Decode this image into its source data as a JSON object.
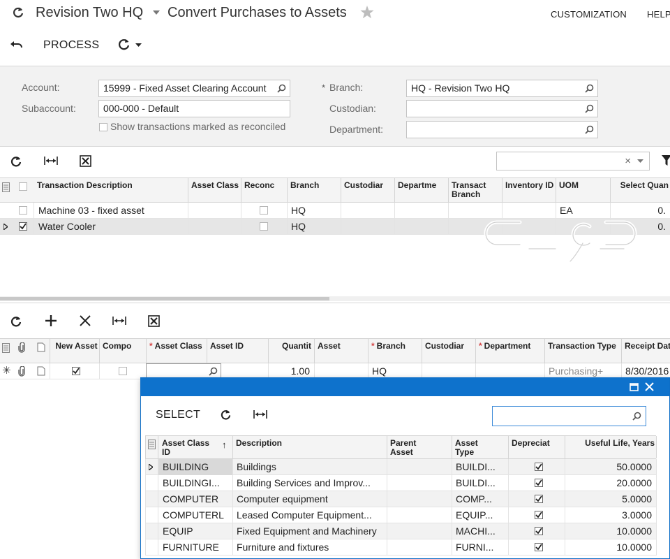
{
  "header": {
    "company": "Revision Two HQ",
    "screen_title": "Convert Purchases to Assets",
    "nav": [
      "CUSTOMIZATION",
      "HELP"
    ]
  },
  "toolbar": {
    "process": "PROCESS"
  },
  "filter": {
    "account_label": "Account:",
    "account_value": "15999 - Fixed Asset Clearing Account",
    "subaccount_label": "Subaccount:",
    "subaccount_value": "000-000 - Default",
    "reconciled_label": "Show transactions marked as reconciled",
    "branch_label": "Branch:",
    "branch_value": "HQ - Revision Two HQ",
    "custodian_label": "Custodian:",
    "custodian_value": "",
    "department_label": "Department:",
    "department_value": ""
  },
  "top_grid": {
    "columns": [
      "Transaction Description",
      "Asset Class",
      "Reconc",
      "Branch",
      "Custodiar",
      "Departme",
      "Transact Branch",
      "Inventory ID",
      "UOM",
      "Select Quan"
    ],
    "rows": [
      {
        "description": "Machine 03 - fixed asset",
        "branch": "HQ",
        "uom": "EA",
        "qty": "0.",
        "selected": false
      },
      {
        "description": "Water Cooler",
        "branch": "HQ",
        "uom": "",
        "qty": "0.",
        "selected": true
      }
    ],
    "watermark": "C_9_D"
  },
  "bottom_grid": {
    "columns": [
      "New Asset",
      "Compo",
      "Asset Class",
      "Asset ID",
      "Quantit",
      "Asset",
      "Branch",
      "Custodiar",
      "Department",
      "Transaction Type",
      "Receipt Dat"
    ],
    "row": {
      "quantity": "1.00",
      "branch": "HQ",
      "transaction_type": "Purchasing+",
      "receipt_date": "8/30/2016"
    }
  },
  "lookup": {
    "select_label": "SELECT",
    "search_placeholder": "",
    "columns": [
      "Asset Class ID",
      "Description",
      "Parent Asset",
      "Asset Type",
      "Depreciat",
      "Useful Life, Years"
    ],
    "rows": [
      {
        "id": "BUILDING",
        "description": "Buildings",
        "type": "BUILDI...",
        "life": "50.0000"
      },
      {
        "id": "BUILDINGI...",
        "description": "Building Services and Improv...",
        "type": "BUILDI...",
        "life": "20.0000"
      },
      {
        "id": "COMPUTER",
        "description": "Computer equipment",
        "type": "COMP...",
        "life": "5.0000"
      },
      {
        "id": "COMPUTERL",
        "description": "Leased Computer Equipment...",
        "type": "EQUIP...",
        "life": "3.0000"
      },
      {
        "id": "EQUIP",
        "description": "Fixed Equipment and Machinery",
        "type": "MACHI...",
        "life": "10.0000"
      },
      {
        "id": "FURNITURE",
        "description": "Furniture and fixtures",
        "type": "FURNI...",
        "life": "10.0000"
      }
    ]
  },
  "colors": {
    "accent": "#0e72cc",
    "required": "#d64545",
    "panel": "#f2f2f2"
  }
}
